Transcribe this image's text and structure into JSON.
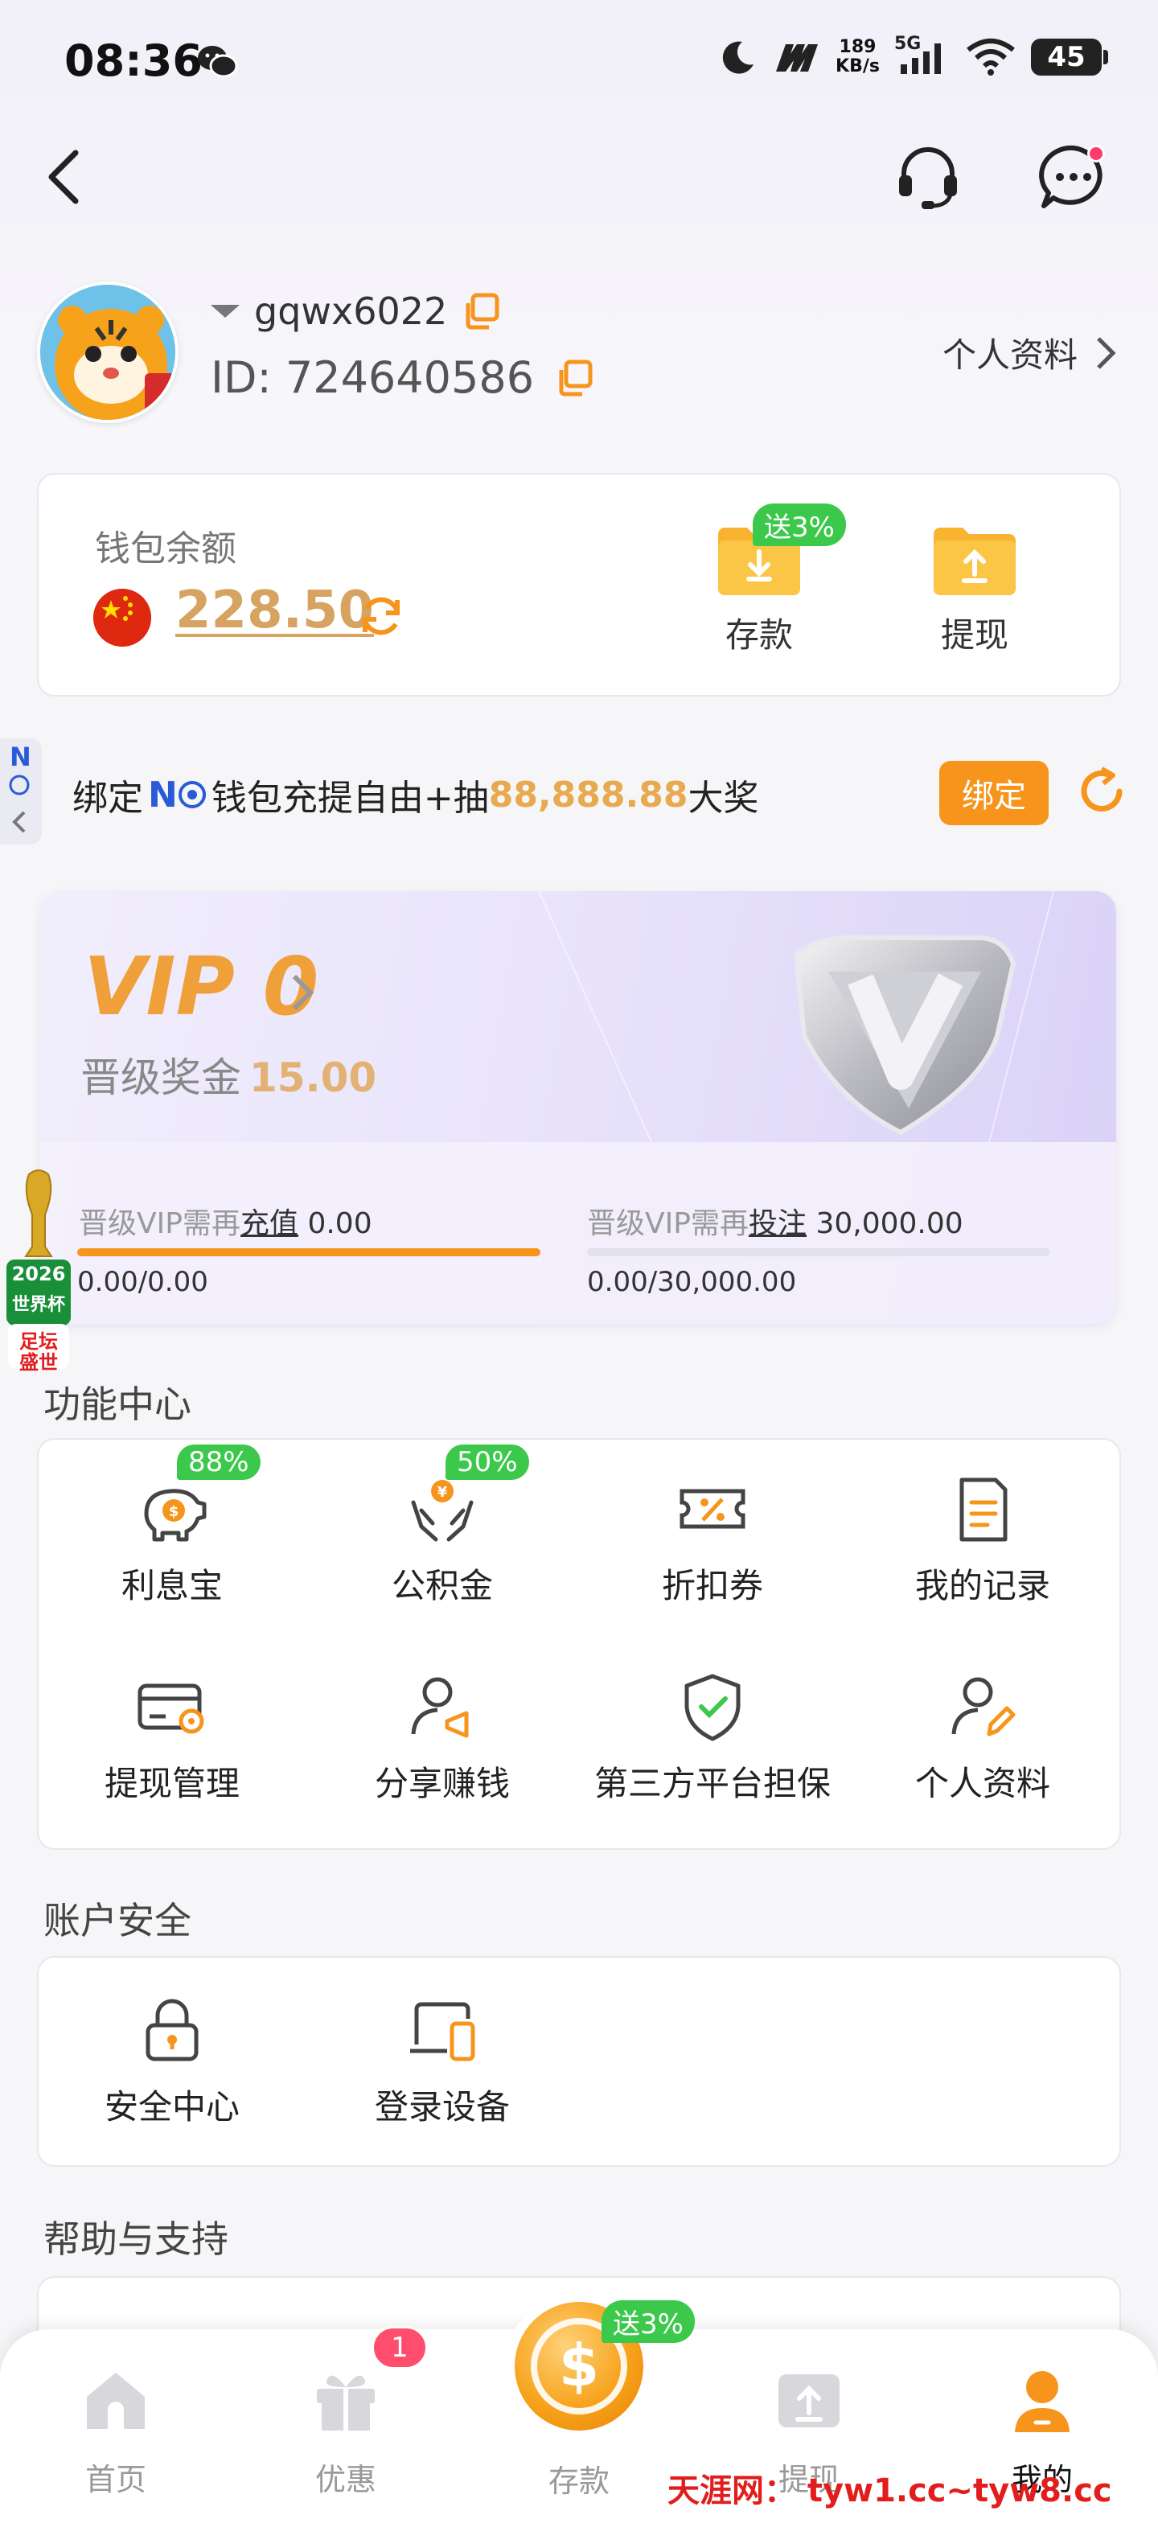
{
  "status_bar": {
    "time": "08:36",
    "net_speed_value": "189",
    "net_speed_unit": "KB/s",
    "network": "5G",
    "battery": "45"
  },
  "header": {
    "back_icon": "chevron-left-icon",
    "support_icon": "headset-icon",
    "message_icon": "chat-bubble-icon"
  },
  "profile": {
    "username": "gqwx6022",
    "id_text": "ID: 724640586",
    "profile_link": "个人资料"
  },
  "wallet": {
    "title": "钱包余额",
    "balance": "228.50",
    "deposit_badge": "送3%",
    "deposit_label": "存款",
    "withdraw_label": "提现"
  },
  "bind_banner": {
    "side_tab": "N",
    "prefix": "绑定",
    "nb": "N",
    "middle": "钱包充提自由+抽",
    "prize": "88,888.88",
    "suffix": "大奖",
    "button": "绑定"
  },
  "vip": {
    "title": "VIP 0",
    "bonus_label": "晋级奖金",
    "bonus_amount": "15.00",
    "deposit_req_prefix": "晋级VIP需再",
    "deposit_req_link": "充值",
    "deposit_req_amount": "0.00",
    "deposit_progress": "0.00/0.00",
    "deposit_fill": 1.0,
    "bet_req_prefix": "晋级VIP需再",
    "bet_req_link": "投注",
    "bet_req_amount": "30,000.00",
    "bet_progress": "0.00/30,000.00",
    "bet_fill": 0.0
  },
  "side_badge": {
    "line1": "2026",
    "line2": "世界杯",
    "line3": "足坛",
    "line4": "盛世"
  },
  "function_center": {
    "title": "功能中心",
    "items": [
      {
        "label": "利息宝",
        "badge": "88%",
        "icon": "piggy-bank-icon"
      },
      {
        "label": "公积金",
        "badge": "50%",
        "icon": "hands-coin-icon"
      },
      {
        "label": "折扣券",
        "badge": "",
        "icon": "coupon-icon"
      },
      {
        "label": "我的记录",
        "badge": "",
        "icon": "document-icon"
      },
      {
        "label": "提现管理",
        "badge": "",
        "icon": "card-gear-icon"
      },
      {
        "label": "分享赚钱",
        "badge": "",
        "icon": "user-megaphone-icon"
      },
      {
        "label": "第三方平台担保",
        "badge": "",
        "icon": "shield-check-icon"
      },
      {
        "label": "个人资料",
        "badge": "",
        "icon": "user-edit-icon"
      }
    ]
  },
  "account_security": {
    "title": "账户安全",
    "items": [
      {
        "label": "安全中心",
        "icon": "lock-icon"
      },
      {
        "label": "登录设备",
        "icon": "devices-icon"
      }
    ]
  },
  "help_support": {
    "title": "帮助与支持"
  },
  "bottom_nav": {
    "items": [
      {
        "label": "首页",
        "icon": "home-icon"
      },
      {
        "label": "优惠",
        "icon": "gift-icon"
      },
      {
        "label": "存款",
        "icon": "coin-icon"
      },
      {
        "label": "提现",
        "icon": "upload-box-icon"
      },
      {
        "label": "我的",
        "icon": "user-icon"
      }
    ],
    "promo_badge": "1",
    "deposit_badge": "送3%",
    "active": "我的"
  },
  "watermark": "天涯网： tyw1.cc~tyw8.cc",
  "colors": {
    "accent_orange": "#f6941c",
    "balance_gold": "#d6a361",
    "badge_green": "#3cc84b",
    "vip_title": "#f0a03a",
    "bind_blue": "#2a5bd7",
    "notify_red": "#ff4d6d"
  }
}
